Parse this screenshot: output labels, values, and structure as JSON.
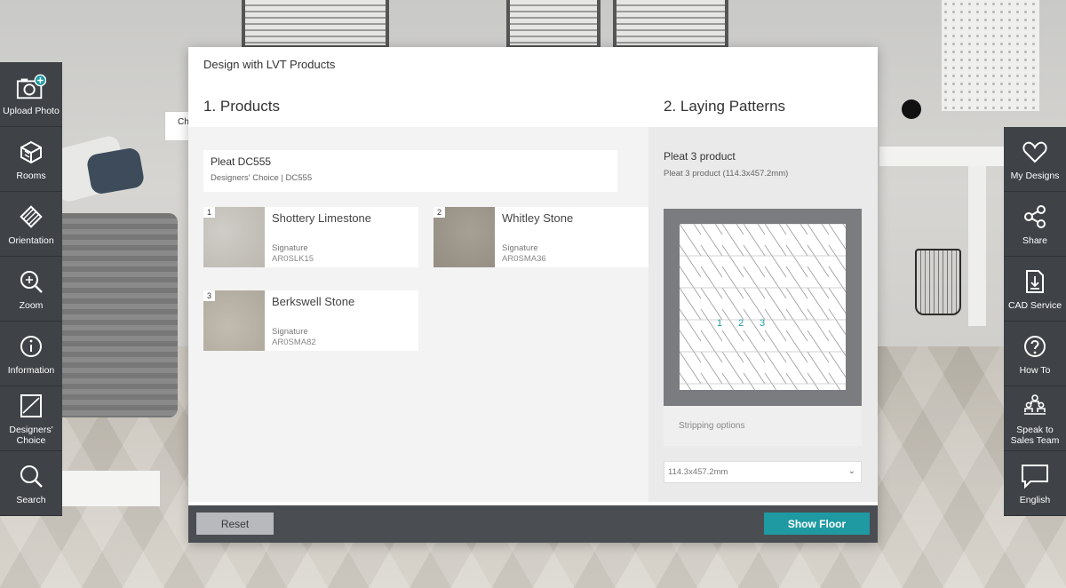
{
  "left_toolbar": [
    {
      "label": "Upload Photo",
      "icon": "camera-plus-icon"
    },
    {
      "label": "Rooms",
      "icon": "cube-icon"
    },
    {
      "label": "Orientation",
      "icon": "tile-rotate-icon"
    },
    {
      "label": "Zoom",
      "icon": "magnifier-plus-icon"
    },
    {
      "label": "Information",
      "icon": "info-circle-icon"
    },
    {
      "label": "Designers'\nChoice",
      "icon": "frame-icon"
    },
    {
      "label": "Search",
      "icon": "search-icon"
    }
  ],
  "right_toolbar": [
    {
      "label": "My Designs",
      "icon": "heart-icon"
    },
    {
      "label": "Share",
      "icon": "share-icon"
    },
    {
      "label": "CAD Service",
      "icon": "download-doc-icon"
    },
    {
      "label": "How To",
      "icon": "question-icon"
    },
    {
      "label": "Speak to\nSales Team",
      "icon": "people-icon"
    },
    {
      "label": "English",
      "icon": "speech-bubble-icon"
    }
  ],
  "background": {
    "chip_text": "Ch"
  },
  "modal": {
    "title": "Design with LVT Products",
    "products_heading": "1. Products",
    "patterns_heading": "2. Laying Patterns",
    "selected": {
      "name": "Pleat DC555",
      "sub": "Designers' Choice | DC555"
    },
    "products": [
      {
        "num": "1",
        "name": "Shottery Limestone",
        "range": "Signature",
        "code": "AR0SLK15"
      },
      {
        "num": "2",
        "name": "Whitley Stone",
        "range": "Signature",
        "code": "AR0SMA36"
      },
      {
        "num": "3",
        "name": "Berkswell Stone",
        "range": "Signature",
        "code": "AR0SMA82"
      }
    ],
    "pattern": {
      "name": "Pleat 3 product",
      "sub": "Pleat 3 product (114.3x457.2mm)",
      "labels": [
        "1",
        "2",
        "3"
      ],
      "stripping": "Stripping options",
      "size_value": "114.3x457.2mm"
    },
    "footer": {
      "reset": "Reset",
      "show_floor": "Show Floor"
    }
  },
  "colors": {
    "accent": "#1f9aa3",
    "toolbar": "#3f4347",
    "footer": "#4a4d51"
  }
}
